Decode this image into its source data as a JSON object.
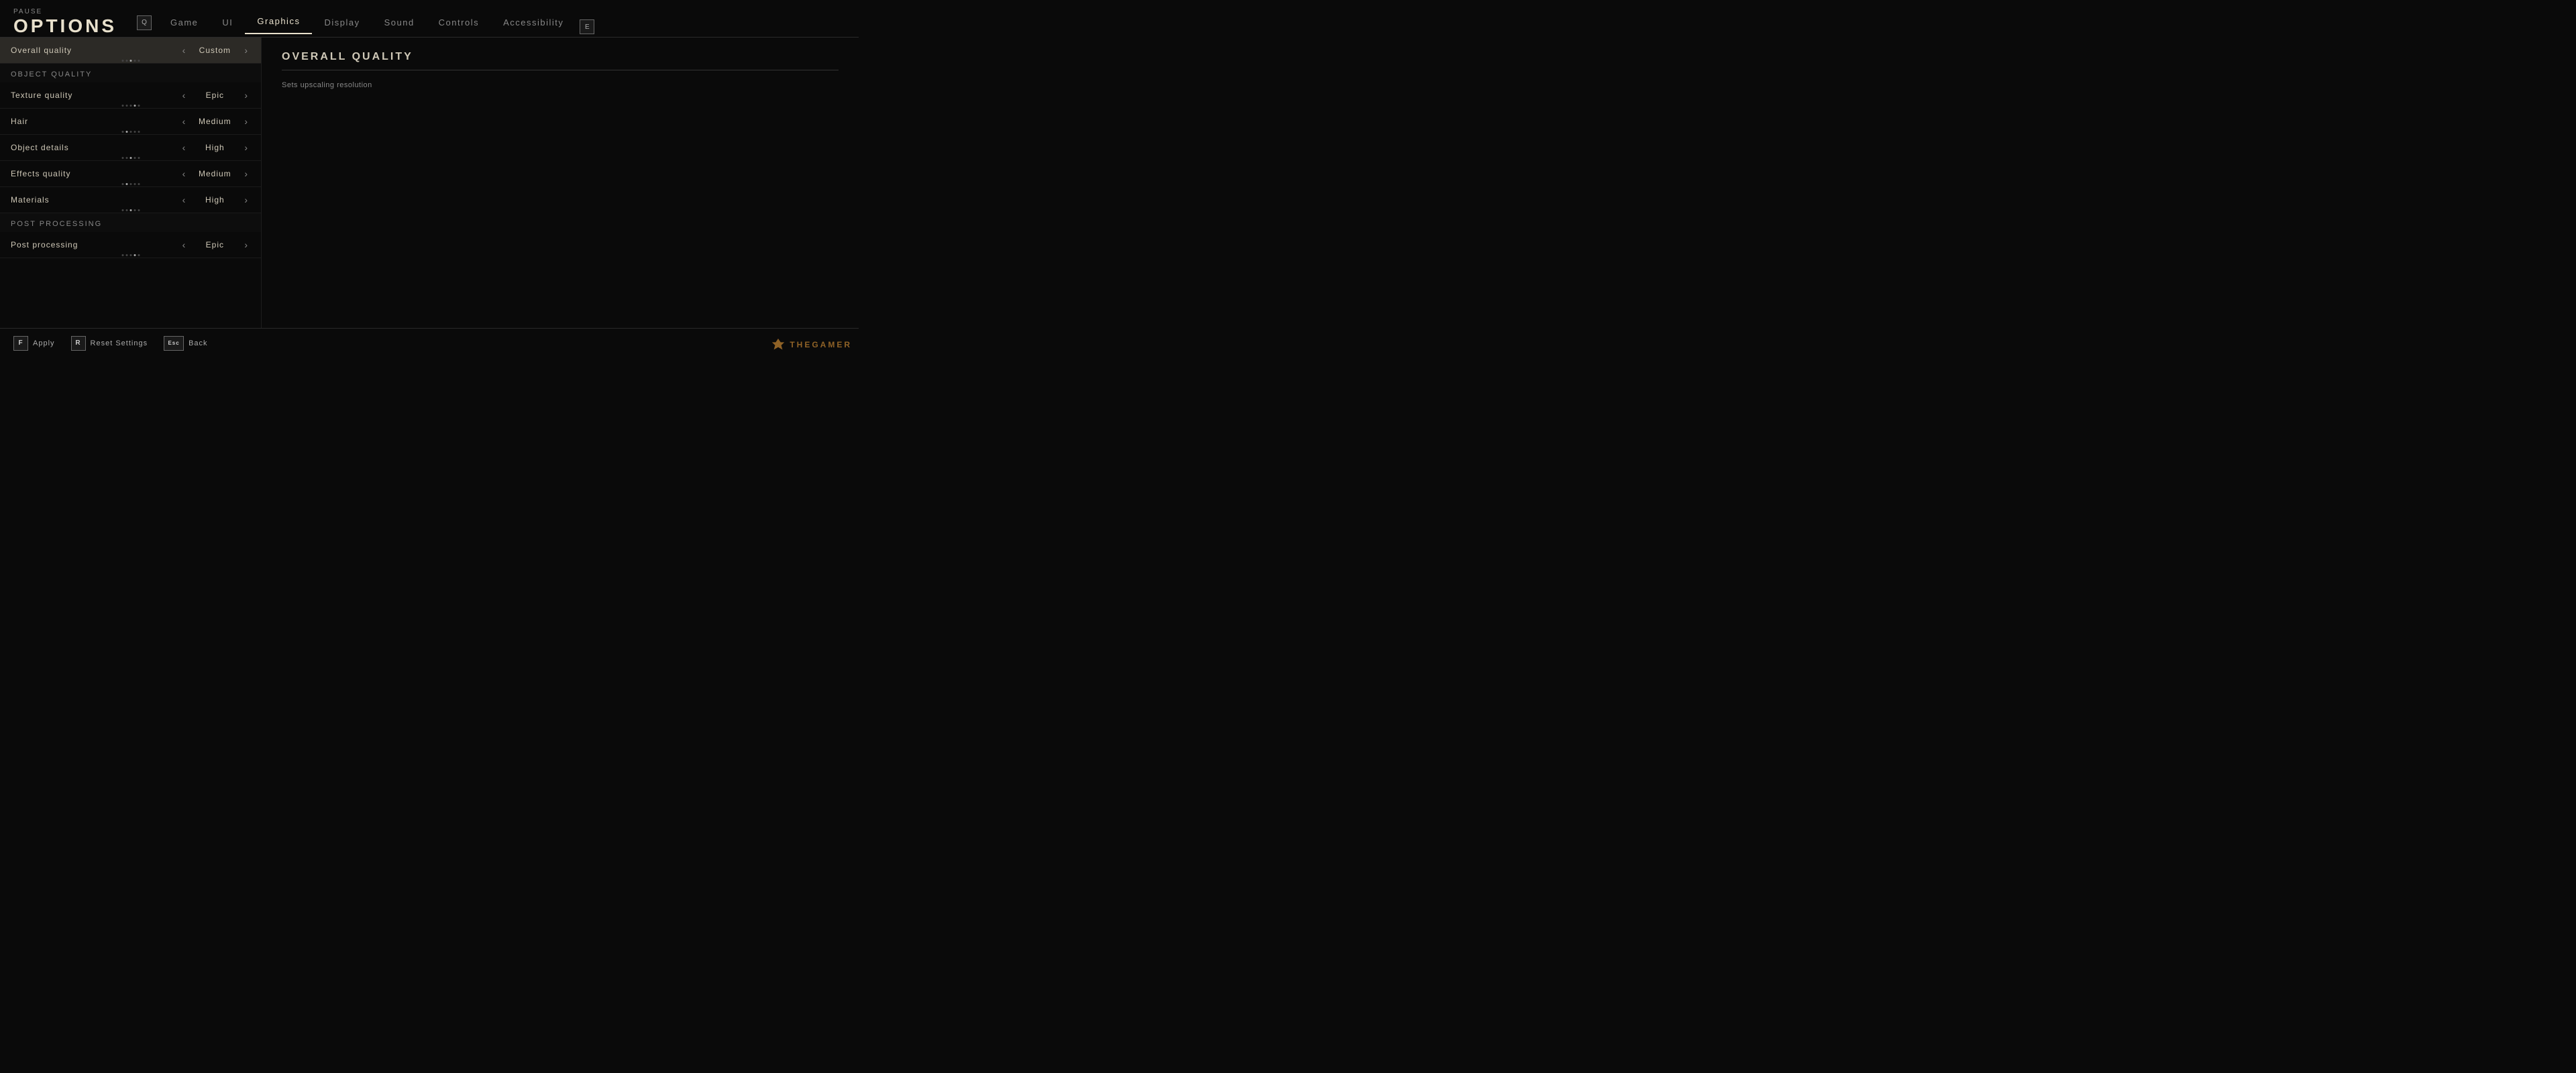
{
  "header": {
    "pause_label": "Pause",
    "options_title": "OPTIONS",
    "q_key": "Q",
    "e_key": "E",
    "tabs": [
      {
        "id": "game",
        "label": "Game",
        "active": false
      },
      {
        "id": "ui",
        "label": "UI",
        "active": false
      },
      {
        "id": "graphics",
        "label": "Graphics",
        "active": true
      },
      {
        "id": "display",
        "label": "Display",
        "active": false
      },
      {
        "id": "sound",
        "label": "Sound",
        "active": false
      },
      {
        "id": "controls",
        "label": "Controls",
        "active": false
      },
      {
        "id": "accessibility",
        "label": "Accessibility",
        "active": false
      }
    ]
  },
  "left_panel": {
    "overall_quality_label": "Overall quality",
    "overall_quality_value": "Custom",
    "sections": [
      {
        "id": "object_quality",
        "header": "Object quality",
        "items": [
          {
            "id": "texture_quality",
            "label": "Texture quality",
            "value": "Epic",
            "dots": 5,
            "active_dot": 4
          },
          {
            "id": "hair",
            "label": "Hair",
            "value": "Medium",
            "dots": 5,
            "active_dot": 2
          },
          {
            "id": "object_details",
            "label": "Object details",
            "value": "High",
            "dots": 5,
            "active_dot": 3
          },
          {
            "id": "effects_quality",
            "label": "Effects quality",
            "value": "Medium",
            "dots": 5,
            "active_dot": 2
          },
          {
            "id": "materials",
            "label": "Materials",
            "value": "High",
            "dots": 5,
            "active_dot": 3
          }
        ]
      },
      {
        "id": "post_processing",
        "header": "Post processing",
        "items": [
          {
            "id": "post_processing",
            "label": "Post processing",
            "value": "Epic",
            "dots": 5,
            "active_dot": 4
          }
        ]
      }
    ]
  },
  "right_panel": {
    "title": "OVERALL QUALITY",
    "description": "Sets upscaling resolution"
  },
  "footer": {
    "apply_key": "F",
    "apply_label": "Apply",
    "reset_key": "R",
    "reset_label": "Reset Settings",
    "back_key": "Esc",
    "back_label": "Back"
  },
  "watermark": {
    "text": "THEGAMER"
  }
}
